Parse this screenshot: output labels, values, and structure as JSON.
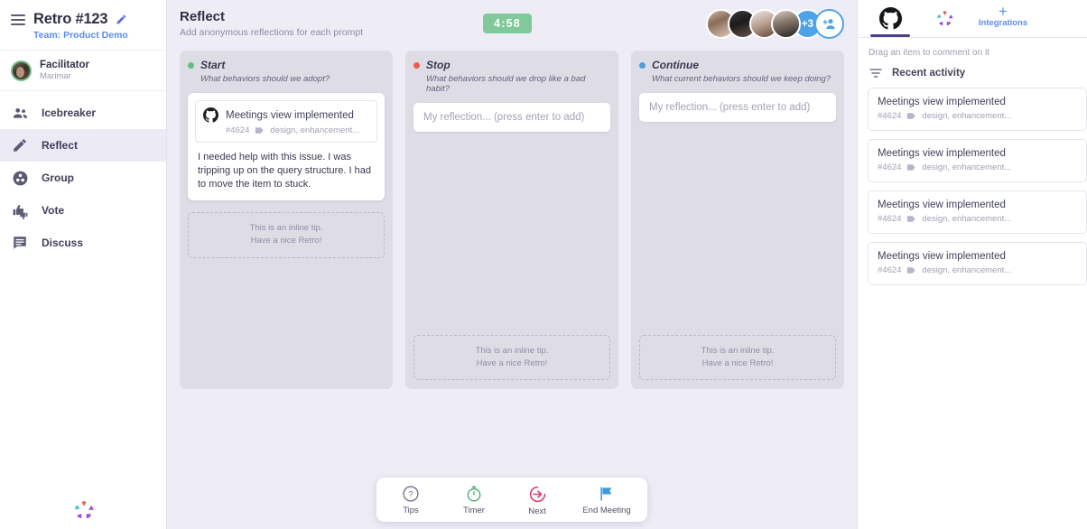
{
  "sidebar": {
    "retro_title": "Retro #123",
    "team_link": "Team: Product Demo",
    "facilitator_role": "Facilitator",
    "facilitator_name": "Marimar",
    "nav": [
      {
        "label": "Icebreaker",
        "icon": "people-icon",
        "active": false
      },
      {
        "label": "Reflect",
        "icon": "pencil-icon",
        "active": true
      },
      {
        "label": "Group",
        "icon": "group-circle-icon",
        "active": false
      },
      {
        "label": "Vote",
        "icon": "thumbs-icon",
        "active": false
      },
      {
        "label": "Discuss",
        "icon": "chat-icon",
        "active": false
      }
    ]
  },
  "header": {
    "title": "Reflect",
    "subtitle": "Add anonymous reflections for each prompt",
    "timer": "4:58",
    "timer_color": "#7fc99a",
    "avatar_overflow": "+3"
  },
  "columns": [
    {
      "name": "Start",
      "prompt": "What behaviors should we adopt?",
      "dot_color": "#66bb81",
      "input_placeholder": "My reflection... (press enter to add)",
      "has_input": false,
      "card": {
        "embed_title": "Meetings view implemented",
        "embed_number": "#4624",
        "embed_tags": "design, enhancement...",
        "body": "I needed help with this issue. I was tripping up on the query structure. I had to move the item to stuck."
      },
      "tip_line1": "This is an inline tip.",
      "tip_line2": "Have a nice Retro!"
    },
    {
      "name": "Stop",
      "prompt": "What behaviors should we drop like a bad habit?",
      "dot_color": "#ec5b4a",
      "input_placeholder": "My reflection... (press enter to add)",
      "has_input": true,
      "card": null,
      "tip_line1": "This is an inline tip.",
      "tip_line2": "Have a nice Retro!"
    },
    {
      "name": "Continue",
      "prompt": "What current behaviors should we keep doing?",
      "dot_color": "#4d9de0",
      "input_placeholder": "My reflection... (press enter to add)",
      "has_input": true,
      "card": null,
      "tip_line1": "This is an inline tip.",
      "tip_line2": "Have a nice Retro!"
    }
  ],
  "toolbar": [
    {
      "label": "Tips",
      "icon": "question-circle-icon",
      "color": "#6f6f8c"
    },
    {
      "label": "Timer",
      "icon": "stopwatch-icon",
      "color": "#4aa96c"
    },
    {
      "label": "Next",
      "icon": "arrow-right-circle-icon",
      "color": "#e0386f"
    },
    {
      "label": "End Meeting",
      "icon": "flag-icon",
      "color": "#3d9ae0"
    }
  ],
  "right_panel": {
    "tabs": [
      {
        "name": "github-tab",
        "active": true
      },
      {
        "name": "parabol-tab",
        "active": false
      }
    ],
    "integrations_label": "Integrations",
    "integrations_plus": "+",
    "drag_hint": "Drag an item to comment on it",
    "recent_activity_label": "Recent activity",
    "activity": [
      {
        "title": "Meetings view implemented",
        "number": "#4624",
        "tags": "design, enhancement..."
      },
      {
        "title": "Meetings view implemented",
        "number": "#4624",
        "tags": "design, enhancement..."
      },
      {
        "title": "Meetings view implemented",
        "number": "#4624",
        "tags": "design, enhancement..."
      },
      {
        "title": "Meetings view implemented",
        "number": "#4624",
        "tags": "design, enhancement..."
      }
    ]
  }
}
